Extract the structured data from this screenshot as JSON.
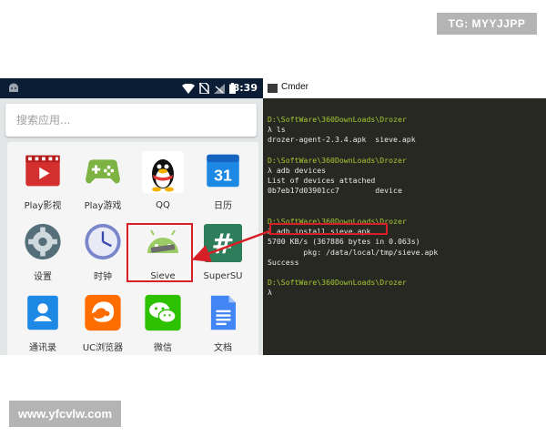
{
  "watermarks": {
    "tg": "TG: MYYJJPP",
    "site": "www.yfcvlw.com"
  },
  "phone": {
    "status_time": "8:39",
    "search_placeholder": "搜索应用...",
    "apps": [
      {
        "label": "Play影视",
        "icon": "play-movies-icon"
      },
      {
        "label": "Play游戏",
        "icon": "play-games-icon"
      },
      {
        "label": "QQ",
        "icon": "qq-penguin-icon"
      },
      {
        "label": "日历",
        "icon": "calendar-icon"
      },
      {
        "label": "设置",
        "icon": "settings-gear-icon"
      },
      {
        "label": "时钟",
        "icon": "clock-icon"
      },
      {
        "label": "Sieve",
        "icon": "android-sieve-icon"
      },
      {
        "label": "SuperSU",
        "icon": "supersu-hash-icon"
      },
      {
        "label": "通讯录",
        "icon": "contacts-icon"
      },
      {
        "label": "UC浏览器",
        "icon": "uc-browser-icon"
      },
      {
        "label": "微信",
        "icon": "wechat-icon"
      },
      {
        "label": "文档",
        "icon": "docs-icon"
      }
    ],
    "calendar_day": "31",
    "supersu_glyph": "#"
  },
  "terminal": {
    "title": "Cmder",
    "lines": [
      {
        "kind": "path",
        "text": "D:\\SoftWare\\360DownLoads\\Drozer"
      },
      {
        "kind": "cmd",
        "text": "λ ls"
      },
      {
        "kind": "out",
        "text": "drozer-agent-2.3.4.apk  sieve.apk"
      },
      {
        "kind": "blank",
        "text": " "
      },
      {
        "kind": "path",
        "text": "D:\\SoftWare\\360DownLoads\\Drozer"
      },
      {
        "kind": "cmd",
        "text": "λ adb devices"
      },
      {
        "kind": "out",
        "text": "List of devices attached"
      },
      {
        "kind": "out",
        "text": "0b7eb17d03901cc7        device"
      },
      {
        "kind": "blank",
        "text": " "
      },
      {
        "kind": "blank",
        "text": " "
      },
      {
        "kind": "path",
        "text": "D:\\SoftWare\\360DownLoads\\Drozer"
      },
      {
        "kind": "cmd",
        "text": "λ adb install sieve.apk"
      },
      {
        "kind": "out",
        "text": "5700 KB/s (367886 bytes in 0.063s)"
      },
      {
        "kind": "out",
        "text": "        pkg: /data/local/tmp/sieve.apk"
      },
      {
        "kind": "out",
        "text": "Success"
      },
      {
        "kind": "blank",
        "text": " "
      },
      {
        "kind": "path",
        "text": "D:\\SoftWare\\360DownLoads\\Drozer"
      },
      {
        "kind": "cmd",
        "text": "λ"
      }
    ]
  },
  "colors": {
    "highlight": "#d61f26",
    "prompt_path": "#a6c832",
    "terminal_bg": "#272822",
    "statusbar": "#0b1d35"
  }
}
